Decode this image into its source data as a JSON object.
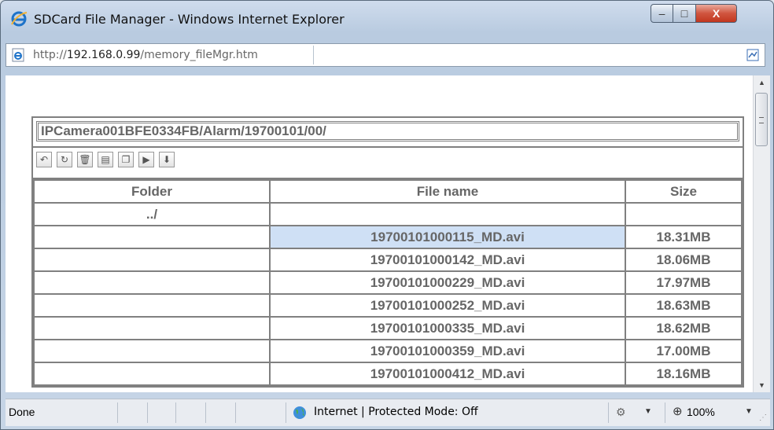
{
  "window": {
    "title": "SDCard File Manager - Windows Internet Explorer",
    "min_glyph": "–",
    "max_glyph": "□",
    "close_glyph": "X"
  },
  "address": {
    "prefix": "http://",
    "host": "192.168.0.99",
    "path": "/memory_fileMgr.htm"
  },
  "file_manager": {
    "path": "IPCamera001BFE0334FB/Alarm/19700101/00/",
    "toolbar": [
      {
        "name": "back-icon",
        "glyph": "↶"
      },
      {
        "name": "refresh-icon",
        "glyph": "↻"
      },
      {
        "name": "delete-icon",
        "glyph": "🗑"
      },
      {
        "name": "select-all-icon",
        "glyph": "▤"
      },
      {
        "name": "copy-icon",
        "glyph": "❐"
      },
      {
        "name": "play-icon",
        "glyph": "▶"
      },
      {
        "name": "download-icon",
        "glyph": "⬇"
      }
    ],
    "columns": {
      "folder": "Folder",
      "file_name": "File name",
      "size": "Size"
    },
    "parent_row": {
      "folder": "../",
      "file_name": "",
      "size": ""
    },
    "rows": [
      {
        "folder": "",
        "file_name": "19700101000115_MD.avi",
        "size": "18.31MB"
      },
      {
        "folder": "",
        "file_name": "19700101000142_MD.avi",
        "size": "18.06MB"
      },
      {
        "folder": "",
        "file_name": "19700101000229_MD.avi",
        "size": "17.97MB"
      },
      {
        "folder": "",
        "file_name": "19700101000252_MD.avi",
        "size": "18.63MB"
      },
      {
        "folder": "",
        "file_name": "19700101000335_MD.avi",
        "size": "18.62MB"
      },
      {
        "folder": "",
        "file_name": "19700101000359_MD.avi",
        "size": "17.00MB"
      },
      {
        "folder": "",
        "file_name": "19700101000412_MD.avi",
        "size": "18.16MB"
      }
    ]
  },
  "status": {
    "done": "Done",
    "zone": "Internet | Protected Mode: Off",
    "zoom": "100%"
  },
  "colors": {
    "selected_row": "#cfe0f5",
    "text": "#666666"
  }
}
